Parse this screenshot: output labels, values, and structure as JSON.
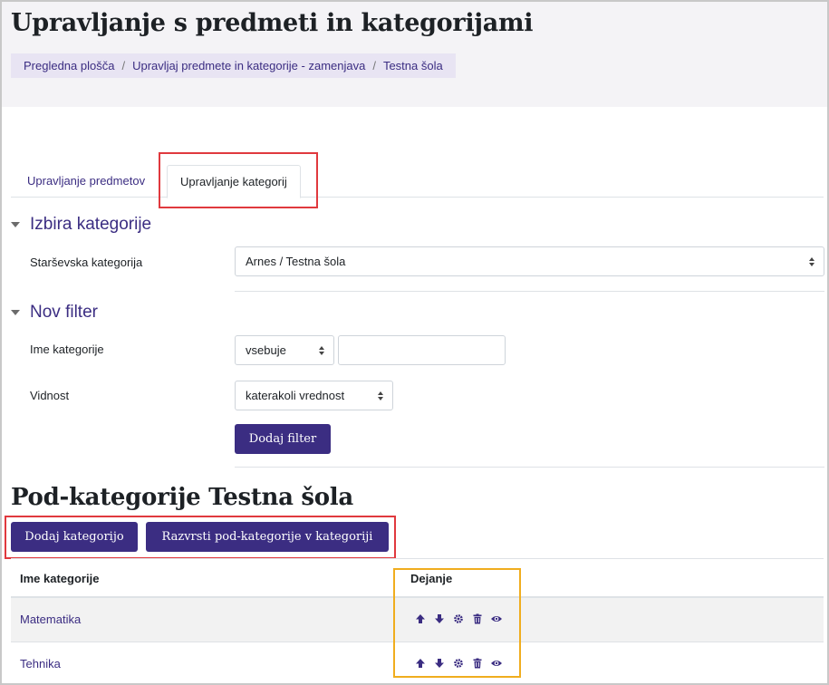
{
  "header": {
    "title": "Upravljanje s predmeti in kategorijami",
    "breadcrumb": [
      "Pregledna plošča",
      "Upravljaj predmete in kategorije - zamenjava",
      "Testna šola"
    ],
    "breadcrumb_sep": "/"
  },
  "tabs": [
    {
      "label": "Upravljanje predmetov",
      "active": false
    },
    {
      "label": "Upravljanje kategorij",
      "active": true
    }
  ],
  "category_section": {
    "heading": "Izbira kategorije",
    "parent_label": "Starševska kategorija",
    "parent_value": "Arnes / Testna šola"
  },
  "filter_section": {
    "heading": "Nov filter",
    "name_label": "Ime kategorije",
    "name_operator": "vsebuje",
    "name_value": "",
    "visibility_label": "Vidnost",
    "visibility_value": "katerakoli vrednost",
    "add_filter_button": "Dodaj filter"
  },
  "subcategories": {
    "title": "Pod-kategorije Testna šola",
    "add_button": "Dodaj kategorijo",
    "sort_button": "Razvrsti pod-kategorije v kategoriji",
    "columns": [
      "Ime kategorije",
      "Dejanje"
    ],
    "rows": [
      {
        "name": "Matematika",
        "actions": [
          "arrow-up-icon",
          "arrow-down-icon",
          "gear-icon",
          "trash-icon",
          "eye-icon"
        ]
      },
      {
        "name": "Tehnika",
        "actions": [
          "arrow-up-icon",
          "arrow-down-icon",
          "gear-icon",
          "trash-icon",
          "eye-icon"
        ]
      }
    ]
  },
  "colors": {
    "accent": "#3b2d82",
    "highlight_red": "#e0393e",
    "highlight_orange": "#f0ad1e"
  }
}
